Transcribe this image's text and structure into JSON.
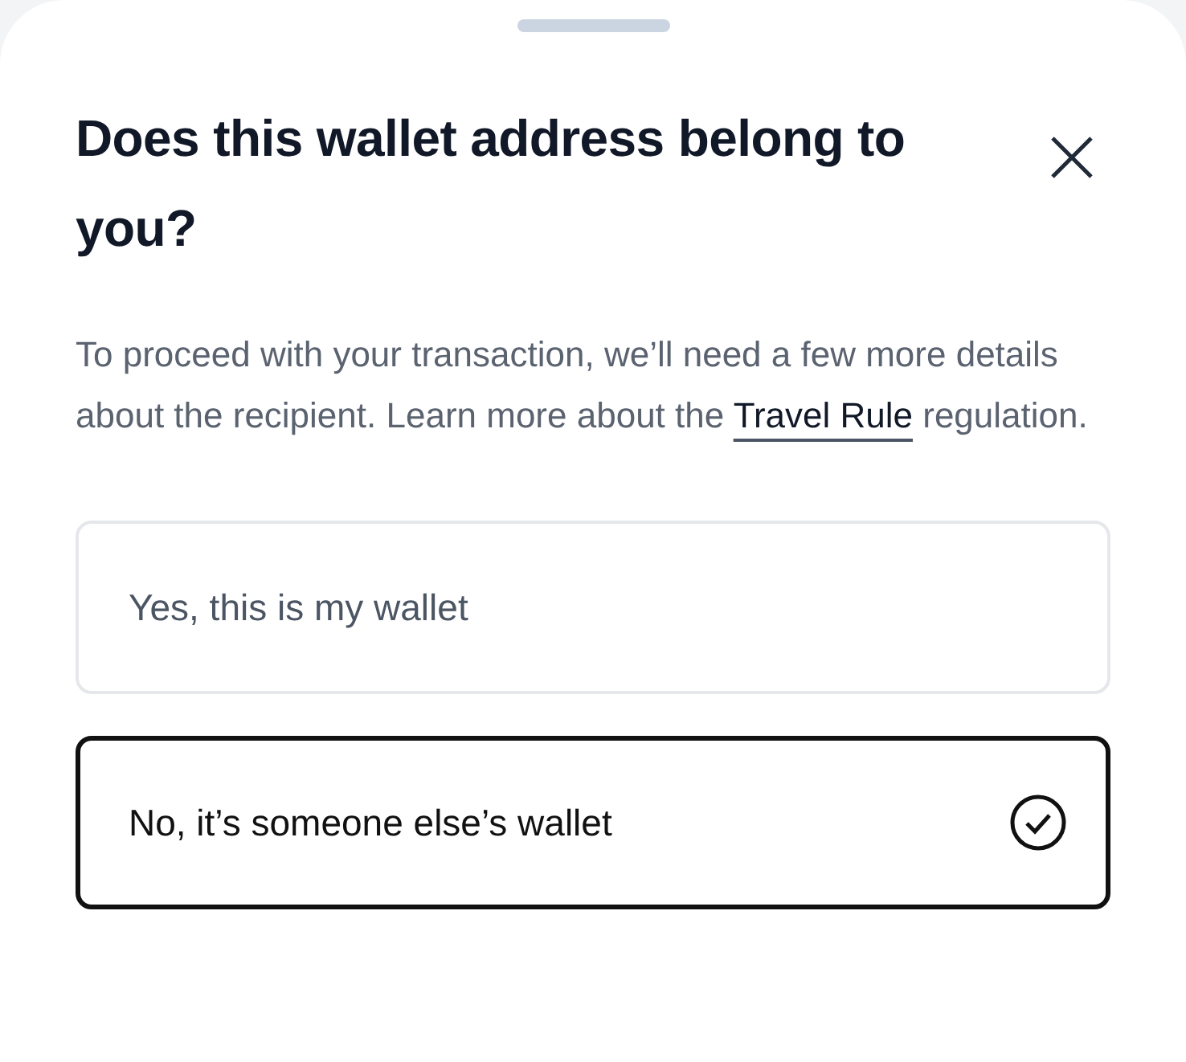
{
  "sheet": {
    "title": "Does this wallet address belong to you?",
    "description": {
      "before": "To proceed with your transaction, we’ll need a few more details about the recipient. Learn more about the",
      "link": "Travel Rule",
      "after": "regulation."
    },
    "options": [
      {
        "label": "Yes, this is my wallet",
        "selected": false
      },
      {
        "label": "No, it’s someone else’s wallet",
        "selected": true
      }
    ]
  }
}
